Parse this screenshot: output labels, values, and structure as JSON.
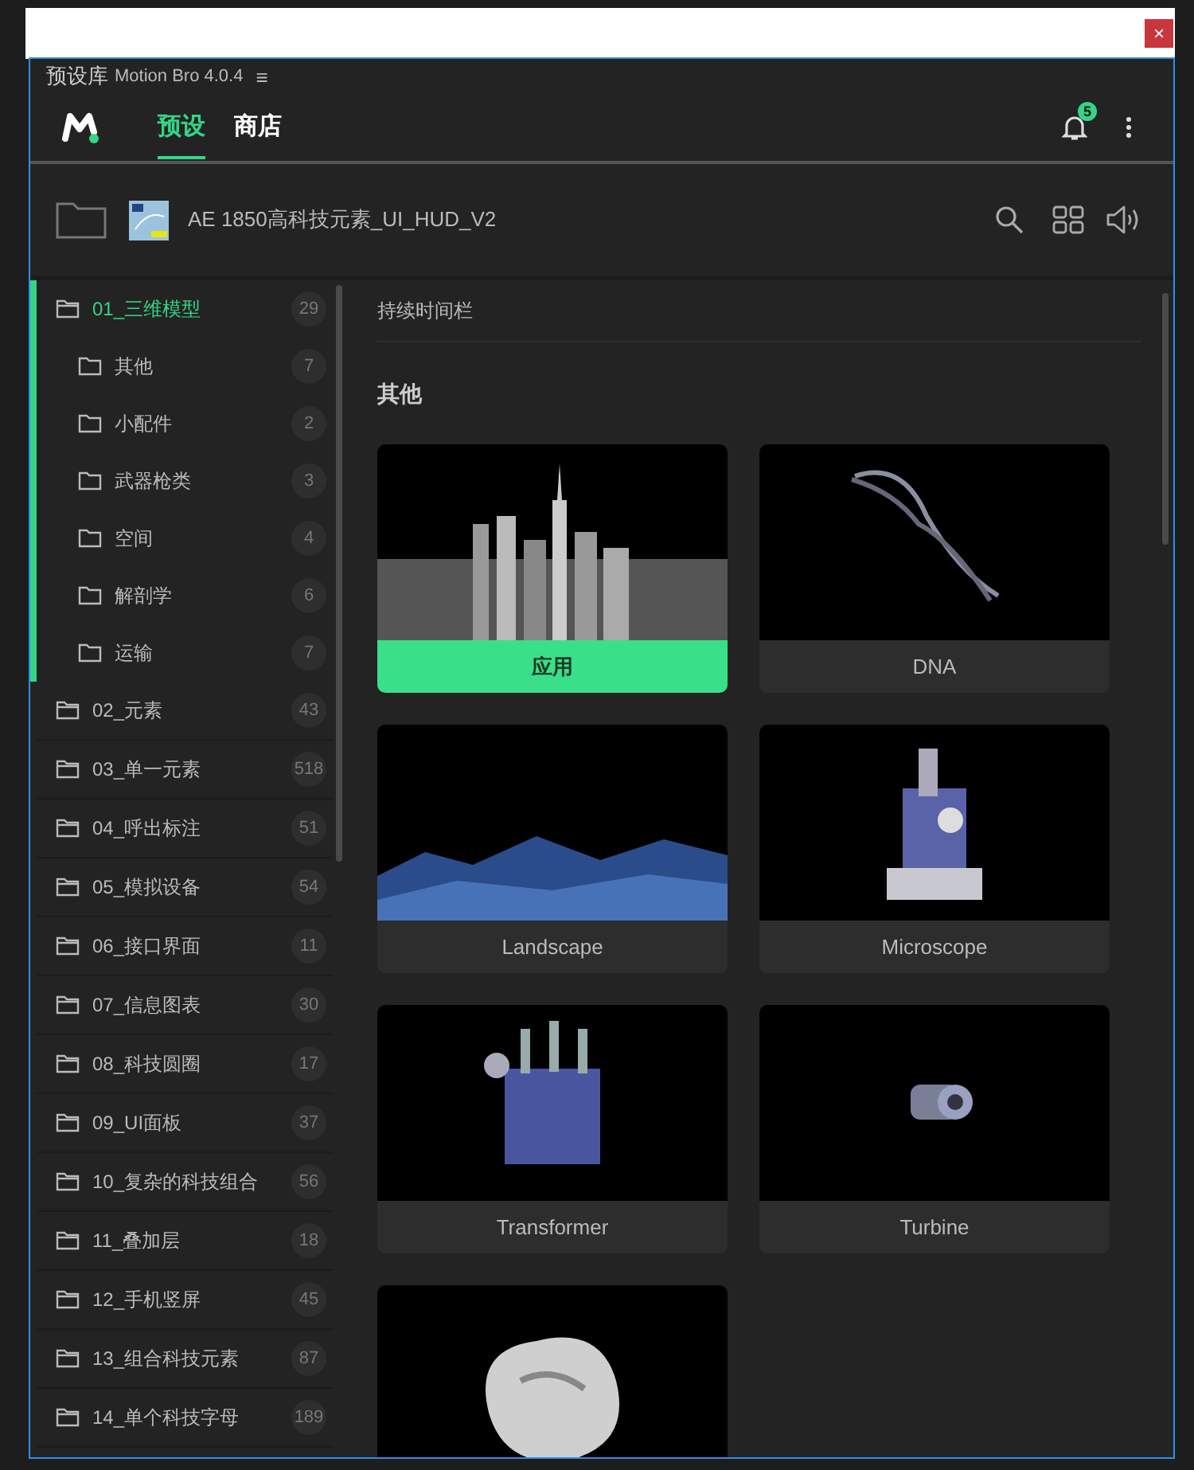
{
  "window": {
    "close": "×"
  },
  "panel": {
    "title": "预设库",
    "subtitle": "Motion Bro 4.0.4",
    "menu": "≡"
  },
  "tabs": [
    {
      "label": "预设",
      "selected": true
    },
    {
      "label": "商店",
      "selected": false
    }
  ],
  "notifications": {
    "count": "5"
  },
  "pack": {
    "title": "AE 1850高科技元素_UI_HUD_V2"
  },
  "sidebar": {
    "items": [
      {
        "label": "01_三维模型",
        "count": "29",
        "selected": true,
        "expanded": true,
        "children": [
          {
            "label": "其他",
            "count": "7",
            "selected": false
          },
          {
            "label": "小配件",
            "count": "2",
            "selected": false
          },
          {
            "label": "武器枪类",
            "count": "3",
            "selected": false
          },
          {
            "label": "空间",
            "count": "4",
            "selected": false
          },
          {
            "label": "解剖学",
            "count": "6",
            "selected": false
          },
          {
            "label": "运输",
            "count": "7",
            "selected": false
          }
        ]
      },
      {
        "label": "02_元素",
        "count": "43",
        "selected": false,
        "expanded": false
      },
      {
        "label": "03_单一元素",
        "count": "518",
        "selected": false,
        "expanded": false
      },
      {
        "label": "04_呼出标注",
        "count": "51",
        "selected": false,
        "expanded": false
      },
      {
        "label": "05_模拟设备",
        "count": "54",
        "selected": false,
        "expanded": false
      },
      {
        "label": "06_接口界面",
        "count": "11",
        "selected": false,
        "expanded": false
      },
      {
        "label": "07_信息图表",
        "count": "30",
        "selected": false,
        "expanded": false
      },
      {
        "label": "08_科技圆圈",
        "count": "17",
        "selected": false,
        "expanded": false
      },
      {
        "label": "09_UI面板",
        "count": "37",
        "selected": false,
        "expanded": false
      },
      {
        "label": "10_复杂的科技组合",
        "count": "56",
        "selected": false,
        "expanded": false
      },
      {
        "label": "11_叠加层",
        "count": "18",
        "selected": false,
        "expanded": false
      },
      {
        "label": "12_手机竖屏",
        "count": "45",
        "selected": false,
        "expanded": false
      },
      {
        "label": "13_组合科技元素",
        "count": "87",
        "selected": false,
        "expanded": false
      },
      {
        "label": "14_单个科技字母",
        "count": "189",
        "selected": false,
        "expanded": false
      }
    ]
  },
  "content": {
    "section": "持续时间栏",
    "group": "其他",
    "cards": [
      {
        "kind": "preset",
        "label": "应用",
        "highlighted": true
      },
      {
        "kind": "preset",
        "label": "DNA",
        "highlighted": false
      },
      {
        "kind": "preset",
        "label": "Landscape",
        "highlighted": false
      },
      {
        "kind": "preset",
        "label": "Microscope",
        "highlighted": false
      },
      {
        "kind": "preset",
        "label": "Transformer",
        "highlighted": false
      },
      {
        "kind": "preset",
        "label": "Turbine",
        "highlighted": false
      },
      {
        "kind": "picture"
      }
    ]
  }
}
